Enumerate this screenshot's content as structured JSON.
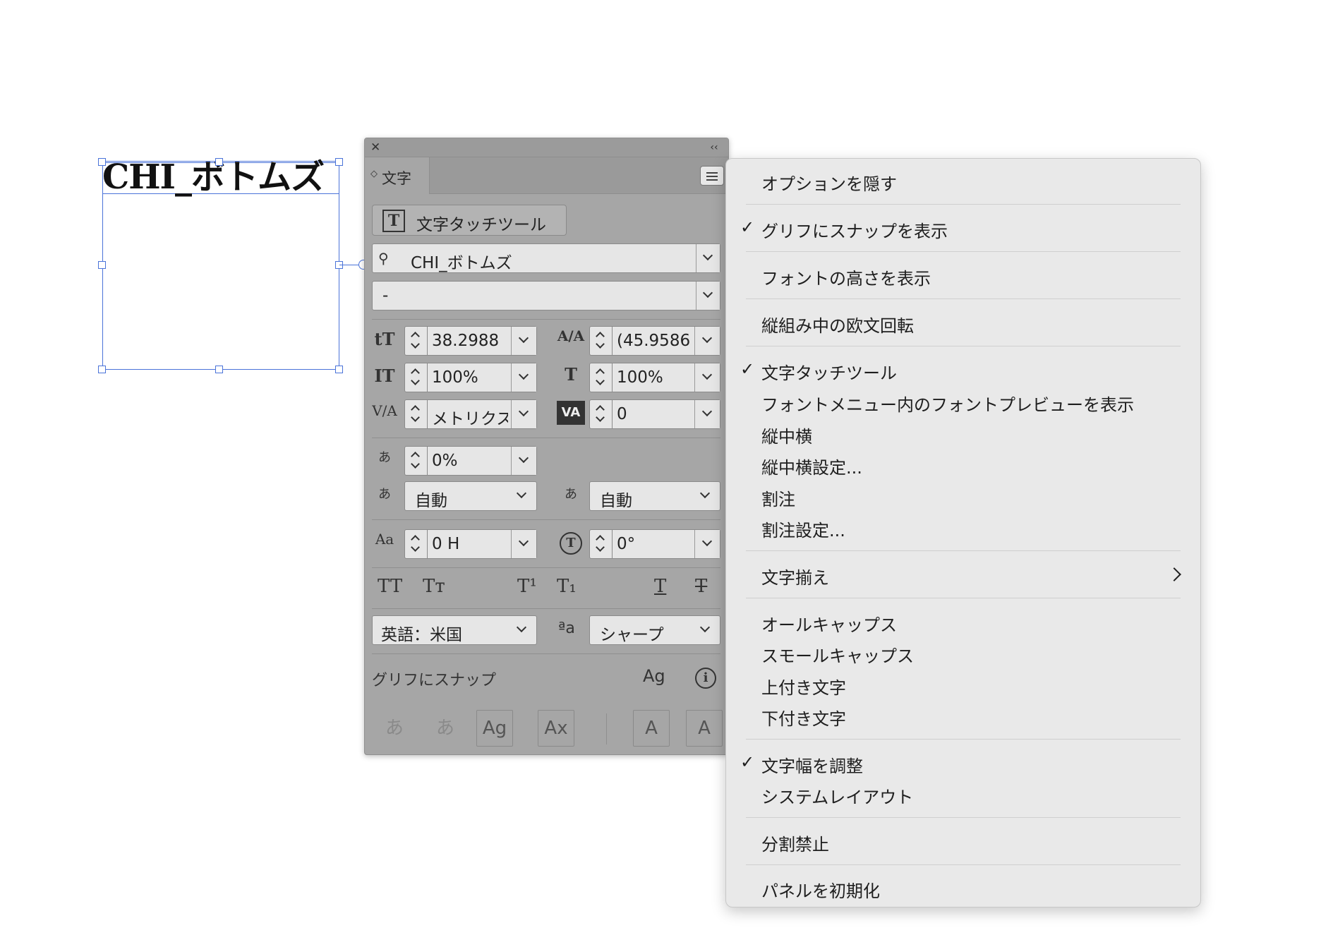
{
  "canvas": {
    "frame_text": "CHI_ボトムズ"
  },
  "panel": {
    "close_glyph": "✕",
    "collapse_glyph": "‹‹",
    "tab_label": "文字",
    "touch_tool_label": "文字タッチツール",
    "font_family": "CHI_ボトムズ",
    "font_style": "-",
    "font_size": "38.2988",
    "leading": "(45.9586",
    "vertical_scale": "100%",
    "horizontal_scale": "100%",
    "kerning": "メトリクス",
    "tracking": "0",
    "tsume": "0%",
    "aki_left": "自動",
    "aki_right": "自動",
    "baseline_shift": "0 H",
    "rotation": "0°",
    "style_buttons": [
      "TT",
      "Tт",
      "T¹",
      "T₁",
      "T",
      "T"
    ],
    "language": "英語：米国",
    "antialias": "シャープ",
    "snap_label": "グリフにスナップ",
    "snap_icons": [
      "あ",
      "あ",
      "Ag",
      "Ax",
      "A",
      "A"
    ],
    "icons": {
      "font_size": "tT",
      "leading": "A/A",
      "vertical_scale": "IT",
      "horizontal_scale": "T",
      "kerning": "V/A",
      "tracking": "VA",
      "tsume": "あ",
      "aki": "あ",
      "baseline": "Aa",
      "rotation": "T",
      "antialias": "ªa",
      "glyph_snap": "Ag",
      "info": "i"
    }
  },
  "menu": {
    "items": [
      {
        "label": "オプションを隠す",
        "checked": false
      },
      {
        "label": "グリフにスナップを表示",
        "checked": true
      },
      {
        "label": "フォントの高さを表示",
        "checked": false
      },
      {
        "label": "縦組み中の欧文回転",
        "checked": false
      },
      {
        "label": "文字タッチツール",
        "checked": true
      },
      {
        "label": "フォントメニュー内のフォントプレビューを表示",
        "checked": false
      },
      {
        "label": "縦中横",
        "checked": false
      },
      {
        "label": "縦中横設定...",
        "checked": false
      },
      {
        "label": "割注",
        "checked": false
      },
      {
        "label": "割注設定...",
        "checked": false
      },
      {
        "label": "文字揃え",
        "checked": false,
        "submenu": true
      },
      {
        "label": "オールキャップス",
        "checked": false
      },
      {
        "label": "スモールキャップス",
        "checked": false
      },
      {
        "label": "上付き文字",
        "checked": false
      },
      {
        "label": "下付き文字",
        "checked": false
      },
      {
        "label": "文字幅を調整",
        "checked": true
      },
      {
        "label": "システムレイアウト",
        "checked": false
      },
      {
        "label": "分割禁止",
        "checked": false
      },
      {
        "label": "パネルを初期化",
        "checked": false
      }
    ],
    "check_glyph": "✓"
  }
}
